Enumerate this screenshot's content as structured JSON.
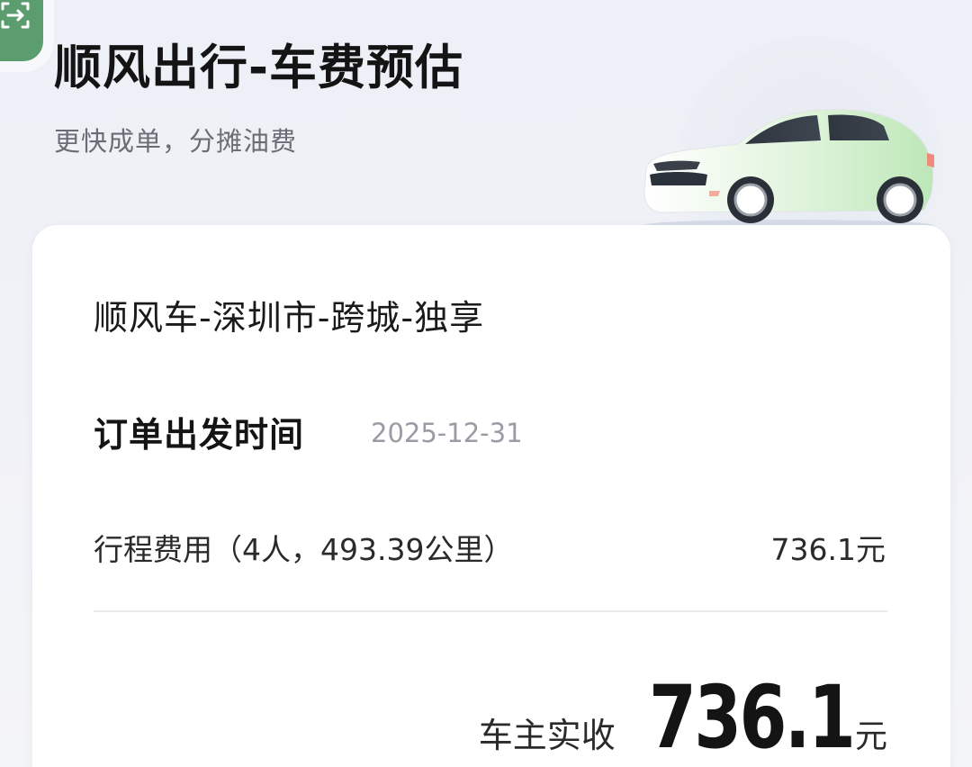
{
  "header": {
    "title": "顺风出行-车费预估",
    "subtitle": "更快成单，分摊油费"
  },
  "card": {
    "product_title": "顺风车-深圳市-跨城-独享",
    "depart_label": "订单出发时间",
    "depart_date": "2025-12-31",
    "fee_label": "行程费用（4人，493.39公里）",
    "fee_value": "736.1元",
    "total_label": "车主实收",
    "total_value": "736.1",
    "total_unit": "元"
  },
  "icons": {
    "corner": "scan-exit-icon",
    "car": "car-illustration"
  },
  "colors": {
    "accent_green": "#5b9d6f",
    "text_primary": "#141414",
    "text_secondary": "#6a6d74",
    "text_muted": "#9a9ca3"
  }
}
